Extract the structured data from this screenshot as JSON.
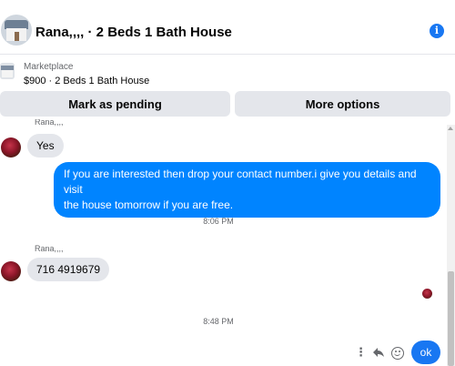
{
  "header": {
    "title": "Rana,,,, · 2 Beds 1 Bath House",
    "info_icon": "i"
  },
  "listing": {
    "category": "Marketplace",
    "name": "$900 · 2 Beds 1 Bath House"
  },
  "actions": {
    "mark_pending": "Mark as pending",
    "more_options": "More options"
  },
  "thread": {
    "top_sender": "Rana,,,,",
    "messages": [
      {
        "from": "them",
        "text": "Yes"
      },
      {
        "from": "me",
        "line1": "If you are interested then drop your contact number.i give you details and visit",
        "line2": "the house tomorrow if you are free."
      },
      {
        "time": "8:06 PM"
      },
      {
        "from": "them",
        "sender": "Rana,,,,",
        "text": "716 4919679"
      },
      {
        "time": "8:48 PM"
      }
    ]
  },
  "composer": {
    "more_icon": "⋮",
    "ok_label": "ok"
  },
  "colors": {
    "accent": "#1877f2",
    "outgoing_bubble": "#0084ff",
    "incoming_bubble": "#e4e6eb",
    "button_bg": "#e4e6eb"
  }
}
